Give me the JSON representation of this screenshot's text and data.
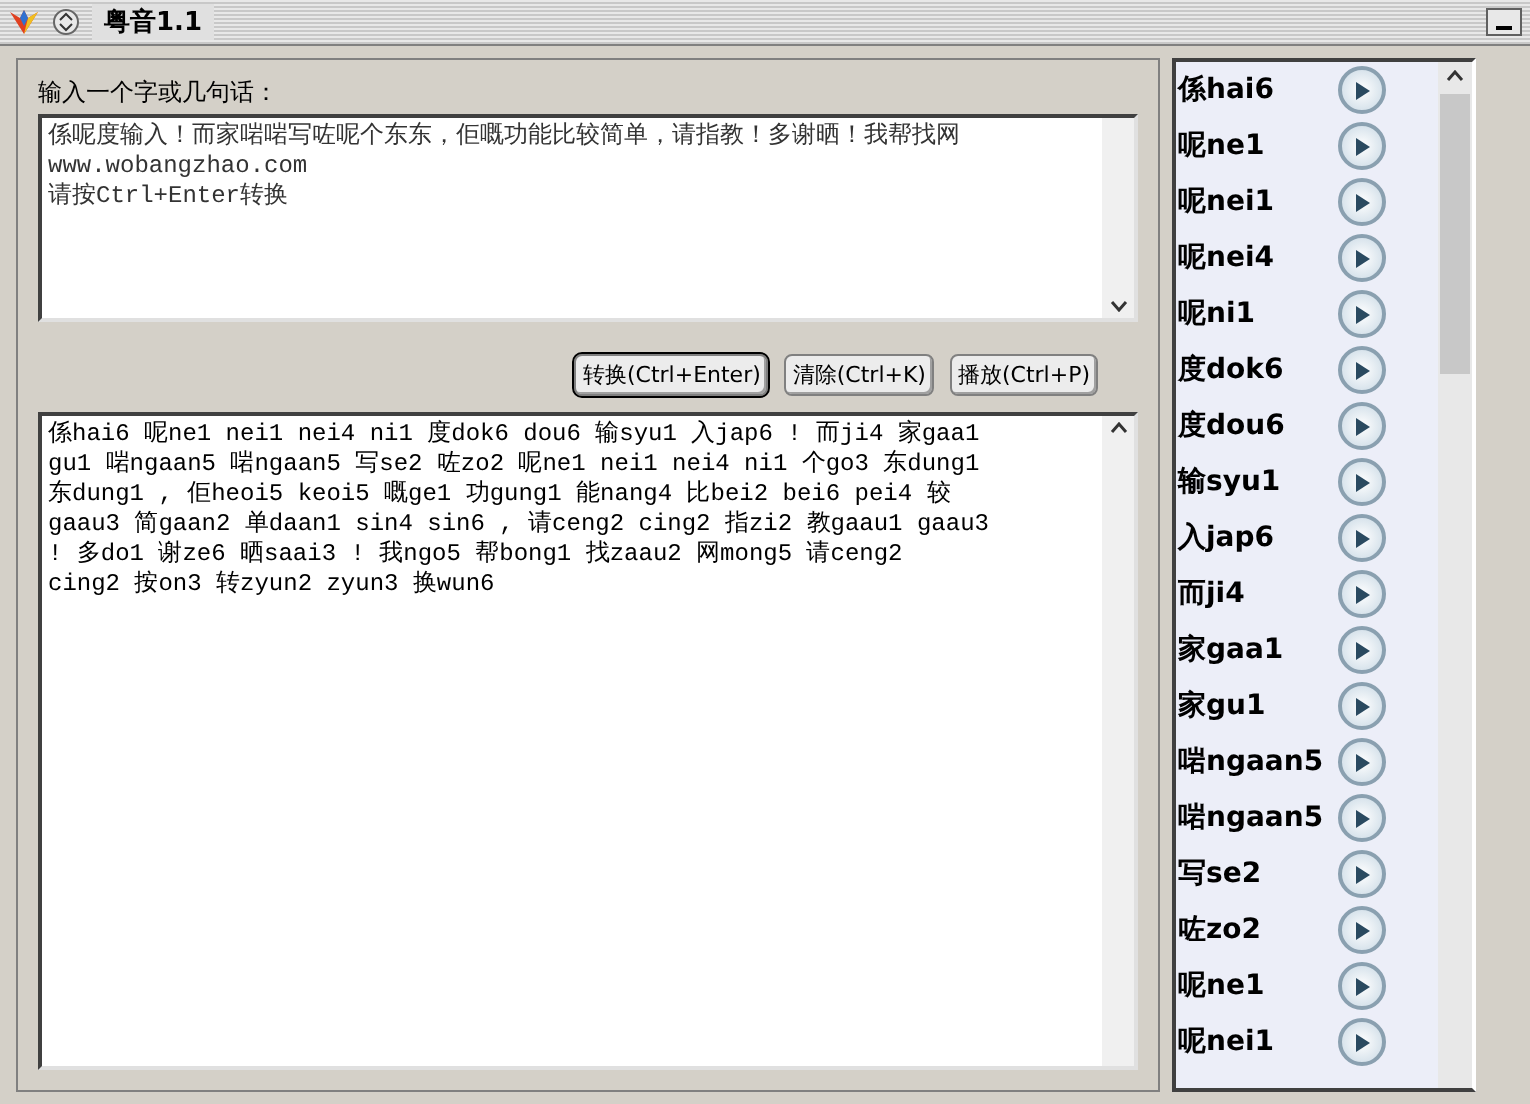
{
  "window": {
    "title": "粤音1.1"
  },
  "input": {
    "label": "输入一个字或几句话：",
    "value": "係呢度输入！而家啱啱写咗呢个东东，佢嘅功能比较简单，请指教！多谢晒！我帮找网 www.wobangzhao.com\n请按Ctrl+Enter转换"
  },
  "buttons": [
    {
      "label": "转换(Ctrl+Enter)",
      "selected": true
    },
    {
      "label": "清除(Ctrl+K)",
      "selected": false
    },
    {
      "label": "播放(Ctrl+P)",
      "selected": false
    }
  ],
  "output": {
    "value": "係hai6 呢ne1 nei1 nei4 ni1 度dok6 dou6 输syu1 入jap6 ! 而ji4 家gaa1\ngu1 啱ngaan5 啱ngaan5 写se2 咗zo2 呢ne1 nei1 nei4 ni1 个go3 东dung1\n东dung1 , 佢heoi5 keoi5 嘅ge1 功gung1 能nang4 比bei2 bei6 pei4 较\ngaau3 简gaan2 单daan1 sin4 sin6 , 请ceng2 cing2 指zi2 教gaau1 gaau3\n! 多do1 谢ze6 晒saai3 ! 我ngo5 帮bong1 找zaau2 网mong5 请ceng2\ncing2 按on3 转zyun2 zyun3 换wun6"
  },
  "syllables": [
    {
      "char": "係",
      "jyutping": "hai6"
    },
    {
      "char": "呢",
      "jyutping": "ne1"
    },
    {
      "char": "呢",
      "jyutping": "nei1"
    },
    {
      "char": "呢",
      "jyutping": "nei4"
    },
    {
      "char": "呢",
      "jyutping": "ni1"
    },
    {
      "char": "度",
      "jyutping": "dok6"
    },
    {
      "char": "度",
      "jyutping": "dou6"
    },
    {
      "char": "输",
      "jyutping": "syu1"
    },
    {
      "char": "入",
      "jyutping": "jap6"
    },
    {
      "char": "而",
      "jyutping": "ji4"
    },
    {
      "char": "家",
      "jyutping": "gaa1"
    },
    {
      "char": "家",
      "jyutping": "gu1"
    },
    {
      "char": "啱",
      "jyutping": "ngaan5"
    },
    {
      "char": "啱",
      "jyutping": "ngaan5"
    },
    {
      "char": "写",
      "jyutping": "se2"
    },
    {
      "char": "咗",
      "jyutping": "zo2"
    },
    {
      "char": "呢",
      "jyutping": "ne1"
    },
    {
      "char": "呢",
      "jyutping": "nei1"
    }
  ]
}
